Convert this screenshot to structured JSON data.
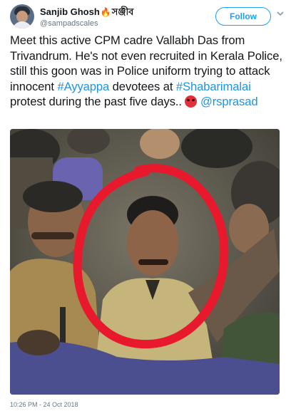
{
  "user": {
    "name": "Sanjib Ghosh",
    "name_suffix": "সঞ্জীব",
    "handle": "@sampadscales"
  },
  "follow_button": {
    "label": "Follow",
    "color": "#1da1f2"
  },
  "tweet": {
    "text_1": "Meet this active CPM cadre Vallabh Das from Trivandrum. He's not even recruited in Kerala Police, still this goon was in Police uniform trying to attack innocent ",
    "hashtag_1": "#Ayyappa",
    "text_2": " devotees at ",
    "hashtag_2": "#Shabarimalai",
    "text_3": " protest during the past five days.. ",
    "mention": "@rsprasad",
    "link_color": "#1b95e0"
  },
  "icons": {
    "flame": "flame-emoji",
    "angry": "angry-face-emoji",
    "more": "chevron-down-icon"
  },
  "timestamp": "10:26 PM - 24 Oct 2018"
}
